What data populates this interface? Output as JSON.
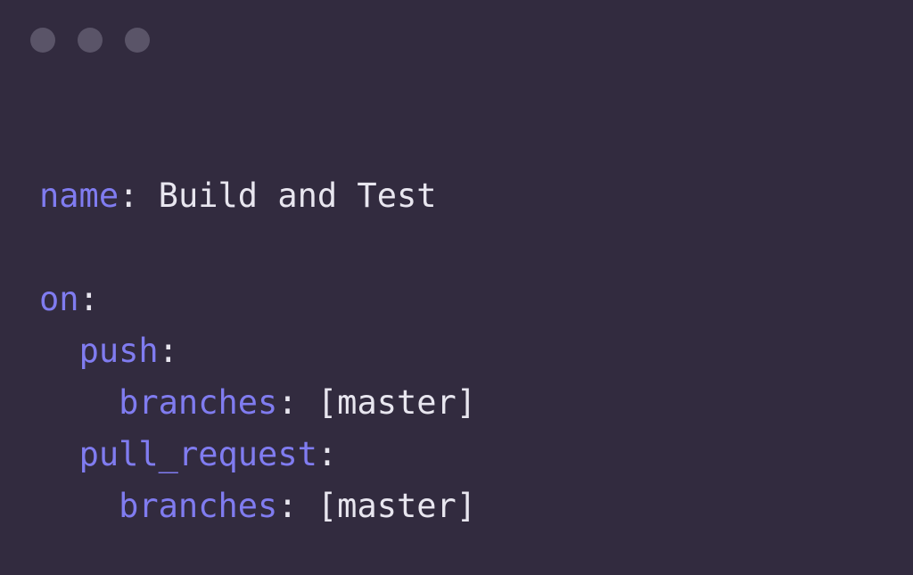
{
  "window": {
    "title": "Build and Test",
    "background_color": "#322b3f",
    "controls": [
      {
        "name": "close",
        "color": "#5a5468"
      },
      {
        "name": "minimize",
        "color": "#5a5468"
      },
      {
        "name": "maximize",
        "color": "#5a5468"
      }
    ]
  },
  "theme": {
    "background": "#322b3f",
    "key_color": "#807cf0",
    "text_color": "#e8e6ef",
    "control_dot_color": "#5a5468"
  },
  "code": {
    "language": "yaml",
    "lines": [
      {
        "indent": "",
        "key": "name",
        "colon": ":",
        "space": " ",
        "value": "Build and Test"
      },
      {
        "indent": "",
        "key": "",
        "colon": "",
        "space": "",
        "value": ""
      },
      {
        "indent": "",
        "key": "on",
        "colon": ":",
        "space": "",
        "value": ""
      },
      {
        "indent": "  ",
        "key": "push",
        "colon": ":",
        "space": "",
        "value": ""
      },
      {
        "indent": "    ",
        "key": "branches",
        "colon": ":",
        "space": " ",
        "value": "[master]"
      },
      {
        "indent": "  ",
        "key": "pull_request",
        "colon": ":",
        "space": "",
        "value": ""
      },
      {
        "indent": "    ",
        "key": "branches",
        "colon": ":",
        "space": " ",
        "value": "[master]"
      }
    ]
  }
}
